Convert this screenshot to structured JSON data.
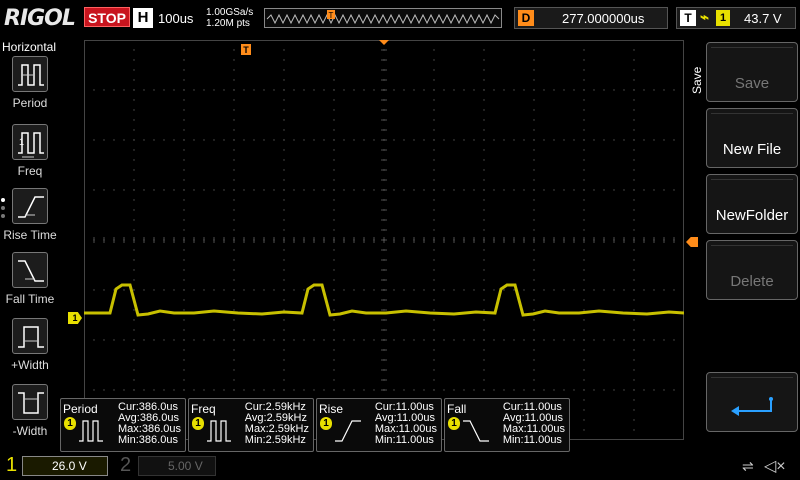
{
  "header": {
    "logo": "RIGOL",
    "run_state": "STOP",
    "horizontal_badge": "H",
    "timebase": "100us",
    "sample_rate": "1.00GSa/s",
    "memory_depth": "1.20M pts",
    "trigger_marker": "T",
    "delay_badge": "D",
    "delay_value": "277.000000us",
    "trigger_badge": "T",
    "trigger_edge": "rising-edge-icon",
    "trigger_source": "1",
    "trigger_level": "43.7 V"
  },
  "left_menu": {
    "title": "Horizontal",
    "items": [
      {
        "label": "Period",
        "icon": "period-icon"
      },
      {
        "label": "Freq",
        "icon": "frequency-icon"
      },
      {
        "label": "Rise Time",
        "icon": "rise-time-icon"
      },
      {
        "label": "Fall Time",
        "icon": "fall-time-icon"
      },
      {
        "label": "+Width",
        "icon": "positive-width-icon"
      },
      {
        "label": "-Width",
        "icon": "negative-width-icon"
      }
    ]
  },
  "right_menu": {
    "title": "Save",
    "buttons": [
      {
        "label": "Save",
        "enabled": false
      },
      {
        "label": "New File",
        "enabled": true
      },
      {
        "label": "NewFolder",
        "enabled": true
      },
      {
        "label": "Delete",
        "enabled": false
      },
      {
        "label": "",
        "icon": "enter-return-icon",
        "enabled": true
      }
    ]
  },
  "waveform": {
    "channel_marker": "1",
    "trigger_top_marker": "T",
    "color": "#c8c000"
  },
  "measurements": [
    {
      "name": "Period",
      "source": "1",
      "cur": "Cur:386.0us",
      "avg": "Avg:386.0us",
      "max": "Max:386.0us",
      "min": "Min:386.0us"
    },
    {
      "name": "Freq",
      "source": "1",
      "cur": "Cur:2.59kHz",
      "avg": "Avg:2.59kHz",
      "max": "Max:2.59kHz",
      "min": "Min:2.59kHz"
    },
    {
      "name": "Rise",
      "source": "1",
      "cur": "Cur:11.00us",
      "avg": "Avg:11.00us",
      "max": "Max:11.00us",
      "min": "Min:11.00us"
    },
    {
      "name": "Fall",
      "source": "1",
      "cur": "Cur:11.00us",
      "avg": "Avg:11.00us",
      "max": "Max:11.00us",
      "min": "Min:11.00us"
    }
  ],
  "channels": [
    {
      "num": "1",
      "scale": "26.0 V",
      "active": true
    },
    {
      "num": "2",
      "scale": "5.00 V",
      "active": false
    }
  ],
  "status_icons": [
    "usb-icon",
    "speaker-muted-icon"
  ]
}
